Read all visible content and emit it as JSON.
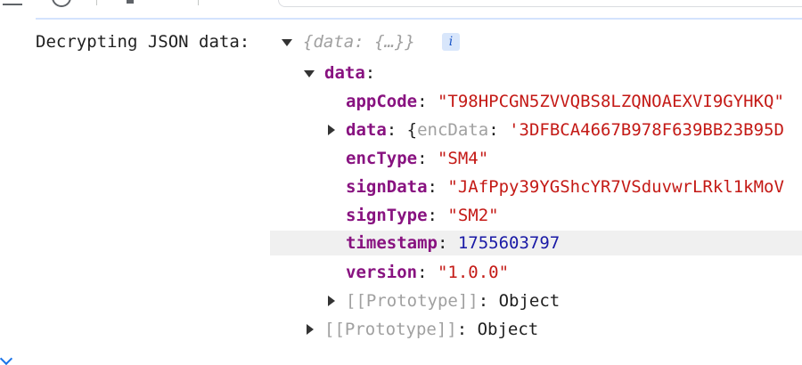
{
  "log": {
    "label": "Decrypting JSON data:",
    "preview": "{data: {…}}",
    "info_glyph": "i"
  },
  "tree": {
    "data_key": "data",
    "appCode": {
      "key": "appCode",
      "value": "\"T98HPCGN5ZVVQBS8LZQNOAEXVI9GYHKQ\""
    },
    "nested": {
      "key": "data",
      "open": "{",
      "inner_key": "encData",
      "inner_value": "'3DFBCA4667B978F639BB23B95D"
    },
    "encType": {
      "key": "encType",
      "value": "\"SM4\""
    },
    "signData": {
      "key": "signData",
      "value": "\"JAfPpy39YGShcYR7VSduvwrLRkl1kMoV"
    },
    "signType": {
      "key": "signType",
      "value": "\"SM2\""
    },
    "timestamp": {
      "key": "timestamp",
      "value": "1755603797"
    },
    "version": {
      "key": "version",
      "value": "\"1.0.0\""
    },
    "proto_inner": {
      "key": "[[Prototype]]",
      "value": "Object"
    },
    "proto_outer": {
      "key": "[[Prototype]]",
      "value": "Object"
    }
  },
  "colors": {
    "key": "#881280",
    "string": "#c41a16",
    "number": "#1a1aa6",
    "highlight_row": "#f0f0f0"
  },
  "icons": [
    "expand-triangle-down-icon",
    "expand-triangle-right-icon",
    "info-icon"
  ]
}
